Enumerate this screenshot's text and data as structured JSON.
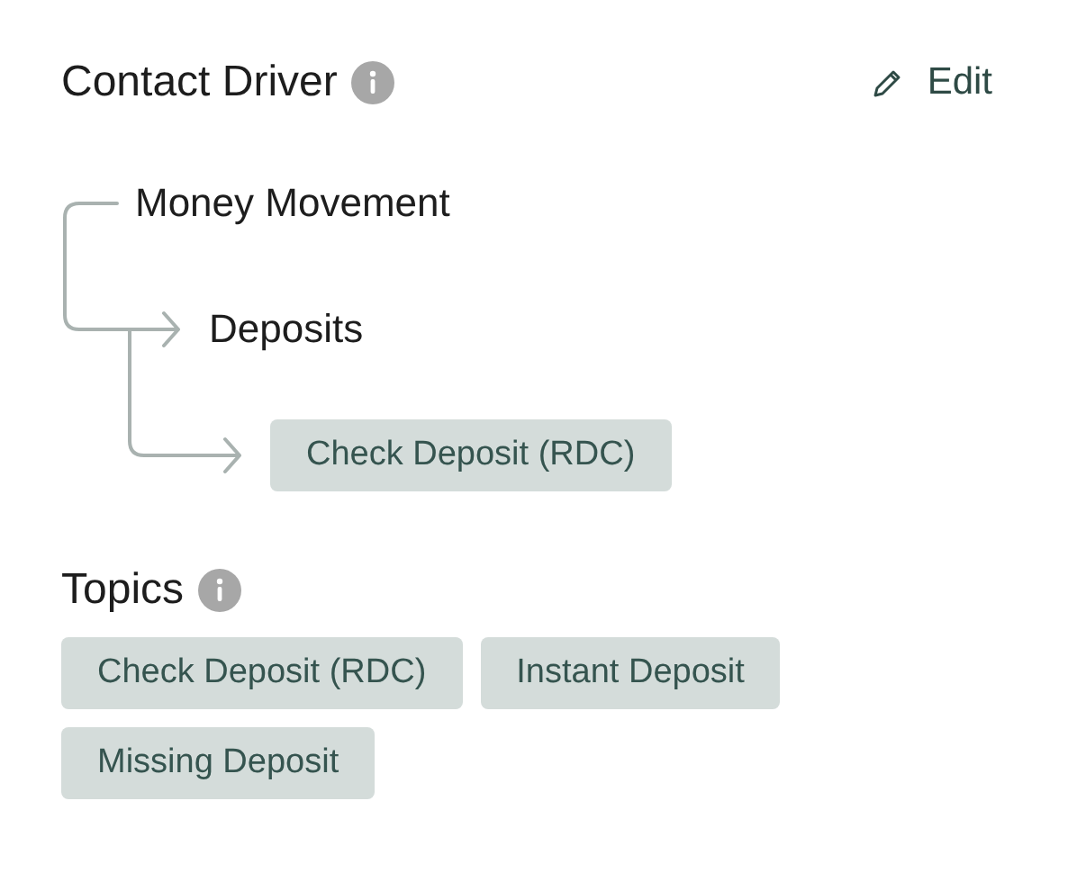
{
  "header": {
    "title": "Contact Driver",
    "edit_label": "Edit"
  },
  "driver_tree": [
    {
      "label": "Money Movement",
      "kind": "text",
      "children": [
        {
          "label": "Deposits",
          "kind": "text",
          "children": [
            {
              "label": "Check Deposit (RDC)",
              "kind": "tag"
            }
          ]
        }
      ]
    }
  ],
  "topics": {
    "title": "Topics",
    "tags": [
      "Check Deposit (RDC)",
      "Instant Deposit",
      "Missing Deposit"
    ]
  }
}
